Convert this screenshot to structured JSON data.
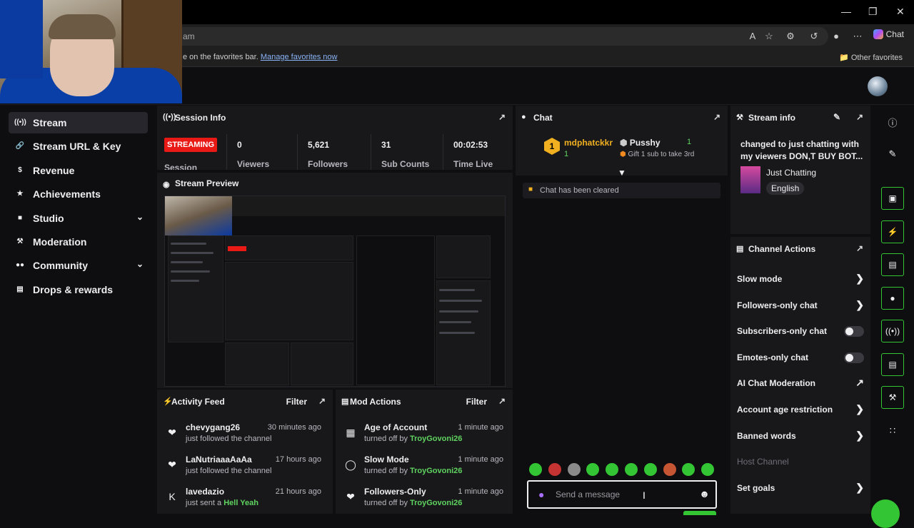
{
  "browser": {
    "url_fragment": "am",
    "fav_message": "e on the favorites bar.",
    "fav_manage": "Manage favorites now",
    "other_favorites": "Other favorites",
    "chat_label": "Chat"
  },
  "nav": {
    "items": [
      {
        "label": "Stream",
        "icon": "stream-icon",
        "active": true
      },
      {
        "label": "Stream URL & Key",
        "icon": "link-icon"
      },
      {
        "label": "Revenue",
        "icon": "revenue-icon"
      },
      {
        "label": "Achievements",
        "icon": "trophy-icon"
      },
      {
        "label": "Studio",
        "icon": "studio-icon",
        "chevron": true
      },
      {
        "label": "Moderation",
        "icon": "wrench-icon"
      },
      {
        "label": "Community",
        "icon": "community-icon",
        "chevron": true
      },
      {
        "label": "Drops & rewards",
        "icon": "gift-icon"
      }
    ]
  },
  "session": {
    "title": "Session Info",
    "status": "STREAMING",
    "status_label": "Session",
    "stats": [
      {
        "value": "0",
        "label": "Viewers"
      },
      {
        "value": "5,621",
        "label": "Followers"
      },
      {
        "value": "31",
        "label": "Sub Counts"
      },
      {
        "value": "00:02:53",
        "label": "Time Live"
      }
    ]
  },
  "preview": {
    "title": "Stream Preview"
  },
  "activity": {
    "title": "Activity Feed",
    "filter": "Filter",
    "items": [
      {
        "name": "chevygang26",
        "sub": "just followed the channel",
        "time": "30 minutes ago",
        "icon": "heart-icon"
      },
      {
        "name": "LaNutriaaaAaAa",
        "sub": "just followed the channel",
        "time": "17 hours ago",
        "icon": "heart-icon"
      },
      {
        "name": "lavedazio",
        "sub_prefix": "just sent a",
        "sub_hl": "Hell Yeah",
        "time": "21 hours ago",
        "icon": "kick-icon"
      }
    ]
  },
  "mod": {
    "title": "Mod Actions",
    "filter": "Filter",
    "items": [
      {
        "name": "Age of Account",
        "by_prefix": "turned off by",
        "by": "TroyGovoni26",
        "time": "1 minute ago",
        "icon": "calendar-icon"
      },
      {
        "name": "Slow Mode",
        "by_prefix": "turned off by",
        "by": "TroyGovoni26",
        "time": "1 minute ago",
        "icon": "snail-icon"
      },
      {
        "name": "Followers-Only",
        "by_prefix": "turned off by",
        "by": "TroyGovoni26",
        "time": "1 minute ago",
        "icon": "heart-icon"
      }
    ]
  },
  "chat": {
    "title": "Chat",
    "hype_user": "mdphatckkr",
    "hype_count": "1",
    "hype_user2": "Pusshy",
    "hype_gift": "Gift 1 sub to take 3rd",
    "hype_one": "1",
    "cleared": "Chat has been cleared",
    "input_placeholder": "Send a message",
    "accent": "#33c533"
  },
  "streaminfo": {
    "title": "Stream info",
    "stream_title": "changed to just chatting with my viewers DON,T BUY BOT...",
    "category": "Just Chatting",
    "tag": "English"
  },
  "actions": {
    "title": "Channel Actions",
    "items": [
      {
        "label": "Slow mode",
        "kind": "chevron"
      },
      {
        "label": "Followers-only chat",
        "kind": "chevron"
      },
      {
        "label": "Subscribers-only chat",
        "kind": "toggle"
      },
      {
        "label": "Emotes-only chat",
        "kind": "toggle"
      },
      {
        "label": "AI Chat Moderation",
        "kind": "external"
      },
      {
        "label": "Account age restriction",
        "kind": "chevron"
      },
      {
        "label": "Banned words",
        "kind": "chevron"
      },
      {
        "label": "Host Channel",
        "kind": "muted"
      },
      {
        "label": "Set goals",
        "kind": "chevron"
      }
    ]
  }
}
